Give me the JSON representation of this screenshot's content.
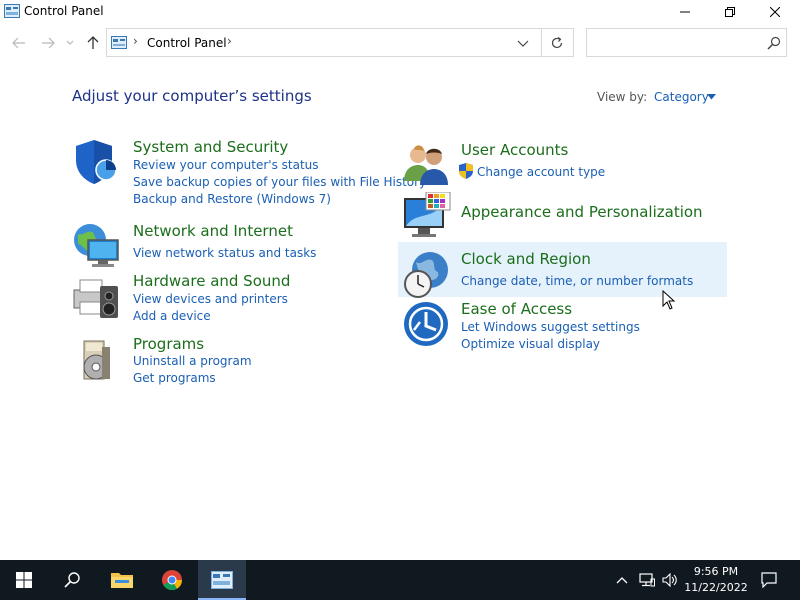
{
  "window": {
    "title": "Control Panel"
  },
  "address_bar": {
    "crumb": "Control Panel",
    "separator": "›"
  },
  "search": {
    "placeholder": "",
    "value": ""
  },
  "content": {
    "heading": "Adjust your computer’s settings",
    "view_by_label": "View by:",
    "view_by_value": "Category",
    "categories": [
      {
        "title": "System and Security",
        "icon": "shield-icon",
        "links": [
          "Review your computer's status",
          "Save backup copies of your files with File History",
          "Backup and Restore (Windows 7)"
        ]
      },
      {
        "title": "Network and Internet",
        "icon": "network-globe-icon",
        "links": [
          "View network status and tasks"
        ]
      },
      {
        "title": "Hardware and Sound",
        "icon": "printer-speaker-icon",
        "links": [
          "View devices and printers",
          "Add a device"
        ]
      },
      {
        "title": "Programs",
        "icon": "programs-disc-icon",
        "links": [
          "Uninstall a program",
          "Get programs"
        ]
      },
      {
        "title": "User Accounts",
        "icon": "users-icon",
        "links": [
          "Change account type"
        ]
      },
      {
        "title": "Appearance and Personalization",
        "icon": "monitor-palette-icon",
        "links": []
      },
      {
        "title": "Clock and Region",
        "icon": "clock-globe-icon",
        "links": [
          "Change date, time, or number formats"
        ]
      },
      {
        "title": "Ease of Access",
        "icon": "ease-of-access-icon",
        "links": [
          "Let Windows suggest settings",
          "Optimize visual display"
        ]
      }
    ]
  },
  "taskbar": {
    "time": "9:56 PM",
    "date": "11/22/2022"
  },
  "colors": {
    "heading": "#1e3287",
    "category_title": "#1b6e1b",
    "link": "#1a5fb4",
    "highlight": "#e5f1fb",
    "taskbar": "#101820"
  }
}
